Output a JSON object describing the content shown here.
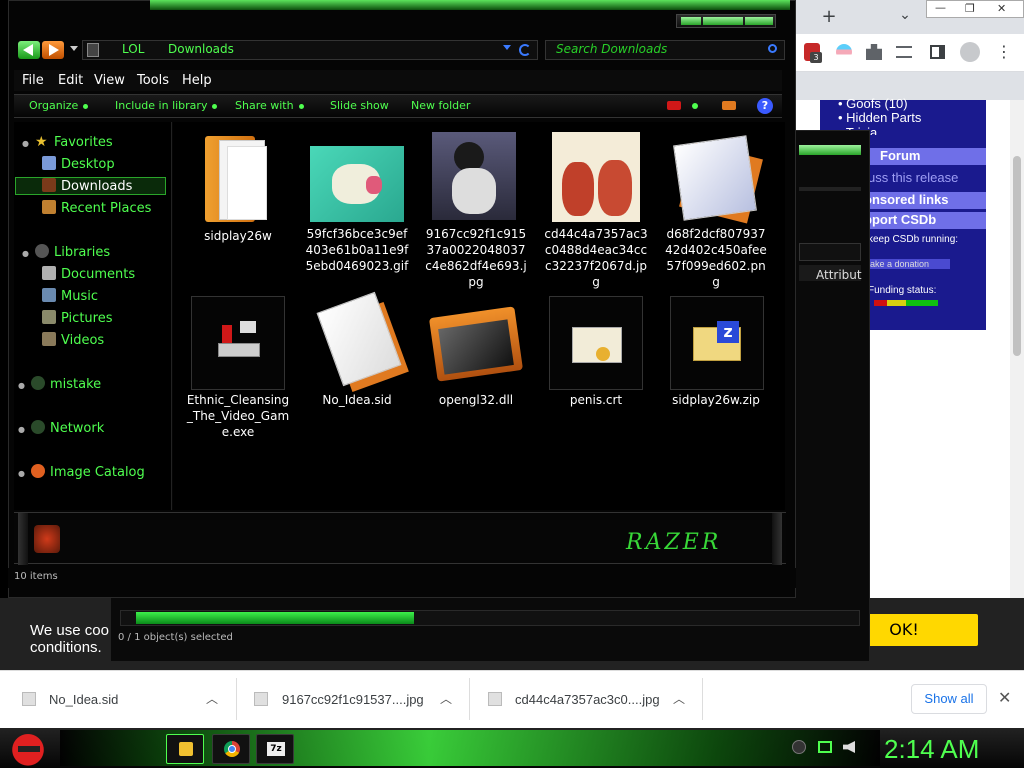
{
  "chrome": {
    "new_tab": "+",
    "tab_menu": "⌄",
    "minimize": "—",
    "maximize": "❐",
    "close": "✕",
    "ext_badge": "3",
    "menu_dots": "⋮"
  },
  "csdb": {
    "goofs": "• Goofs (10)",
    "hidden_parts": "• Hidden Parts",
    "trivia": "• Trivia",
    "forum": "Forum",
    "discuss": "uss this release",
    "sponsored": "onsored links",
    "support": "pport CSDb",
    "keep_running": "keep CSDb running:",
    "donation": "ake a donation",
    "funding": "Funding status:"
  },
  "cookie": {
    "text_line1": "We use coo",
    "text_line2": "conditions.",
    "ok": "OK!"
  },
  "explorer2": {
    "status": "0 / 1 object(s) selected",
    "attrib": "Attribut"
  },
  "explorer": {
    "address": {
      "part1": "LOL",
      "part2": "Downloads"
    },
    "search_placeholder": "Search Downloads",
    "menu": [
      "File",
      "Edit",
      "View",
      "Tools",
      "Help"
    ],
    "commands": [
      "Organize",
      "Include in library",
      "Share with",
      "Slide show",
      "New folder"
    ],
    "help": "?",
    "nav": {
      "favorites": "Favorites",
      "desktop": "Desktop",
      "downloads": "Downloads",
      "recent": "Recent Places",
      "libraries": "Libraries",
      "documents": "Documents",
      "music": "Music",
      "pictures": "Pictures",
      "videos": "Videos",
      "mistake": "mistake",
      "network": "Network",
      "image_catalog": "Image Catalog"
    },
    "files": [
      "sidplay26w",
      "59fcf36bce3c9ef403e61b0a11e9f5ebd0469023.gif",
      "9167cc92f1c91537a0022048037c4e862df4e693.jpg",
      "cd44c4a7357ac3c0488d4eac34ccc32237f2067d.jpg",
      "d68f2dcf80793742d402c450afee57f099ed602.png",
      "Ethnic_Cleansing_The_Video_Game.exe",
      "No_Idea.sid",
      "opengl32.dll",
      "penis.crt",
      "sidplay26w.zip"
    ],
    "status": "10 items",
    "brand": "RAZER"
  },
  "downloads": {
    "items": [
      "No_Idea.sid",
      "9167cc92f1c91537....jpg",
      "cd44c4a7357ac3c0....jpg"
    ],
    "show_all": "Show all",
    "close": "✕"
  },
  "taskbar": {
    "clock": "2:14 AM"
  }
}
